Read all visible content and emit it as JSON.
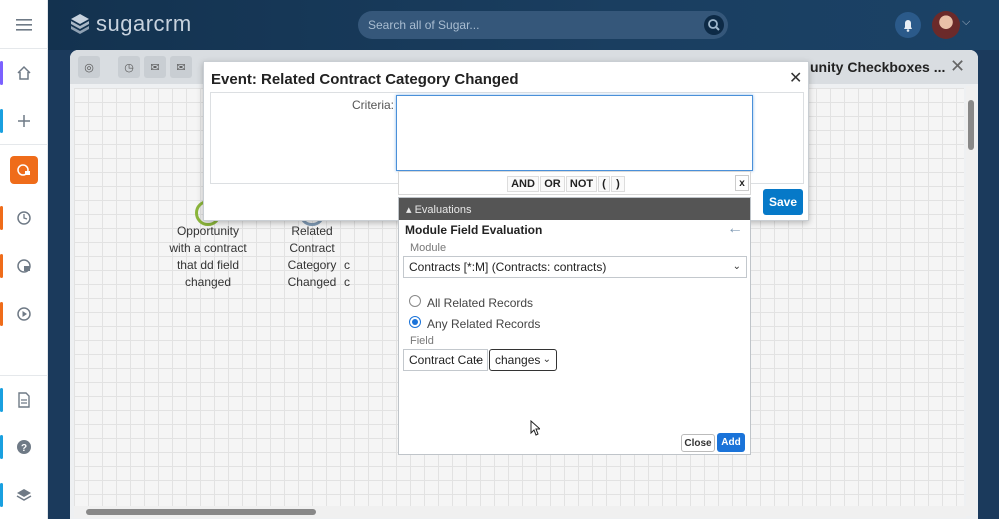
{
  "app": {
    "logo_text": "sugarcrm"
  },
  "search": {
    "placeholder": "Search all of Sugar..."
  },
  "sidebar": {
    "items": [
      {
        "icon": "menu-icon",
        "accent": ""
      },
      {
        "icon": "home-icon",
        "accent": "#7b61ff"
      },
      {
        "icon": "plus-icon",
        "accent": "#19a0e0"
      },
      {
        "icon": "process-definitions-icon",
        "accent": "#ef6c1a"
      },
      {
        "icon": "process-icon",
        "accent": "#ef6c1a"
      },
      {
        "icon": "process-email-icon",
        "accent": "#ef6c1a"
      },
      {
        "icon": "play-icon",
        "accent": "#ef6c1a"
      },
      {
        "icon": "document-icon",
        "accent": "#19a0e0"
      },
      {
        "icon": "help-icon",
        "accent": "#19a0e0"
      },
      {
        "icon": "layers-icon",
        "accent": "#19a0e0"
      }
    ]
  },
  "background": {
    "title": "unity Checkboxes ...",
    "nodes": [
      {
        "label_lines": [
          "Opportunity",
          "with a contract",
          "that dd field",
          "changed"
        ],
        "color": "#8cb63c"
      },
      {
        "label_lines": [
          "Related",
          "Contract",
          "Category",
          "Changed"
        ],
        "color": "#7f9ab4"
      }
    ],
    "partial_labels": [
      "c",
      "c"
    ]
  },
  "dialog": {
    "title": "Event: Related Contract Category Changed",
    "criteria_label": "Criteria:",
    "save_label": "Save"
  },
  "operators": [
    "AND",
    "OR",
    "NOT",
    "(",
    ")"
  ],
  "operator_close": "x",
  "evaluations": {
    "header": "▴ Evaluations",
    "panel_title": "Module Field Evaluation",
    "module_label": "Module",
    "module_value": "Contracts [*:M] (Contracts: contracts)",
    "radio_all": "All Related Records",
    "radio_any": "Any Related Records",
    "selected_radio": "any",
    "field_label": "Field",
    "field_value": "Contract Cate",
    "operator_value": "changes",
    "close_label": "Close",
    "add_label": "Add"
  },
  "colors": {
    "accent": "#0679c8",
    "add": "#1a73d9",
    "active_module": "#ef6c1a"
  }
}
